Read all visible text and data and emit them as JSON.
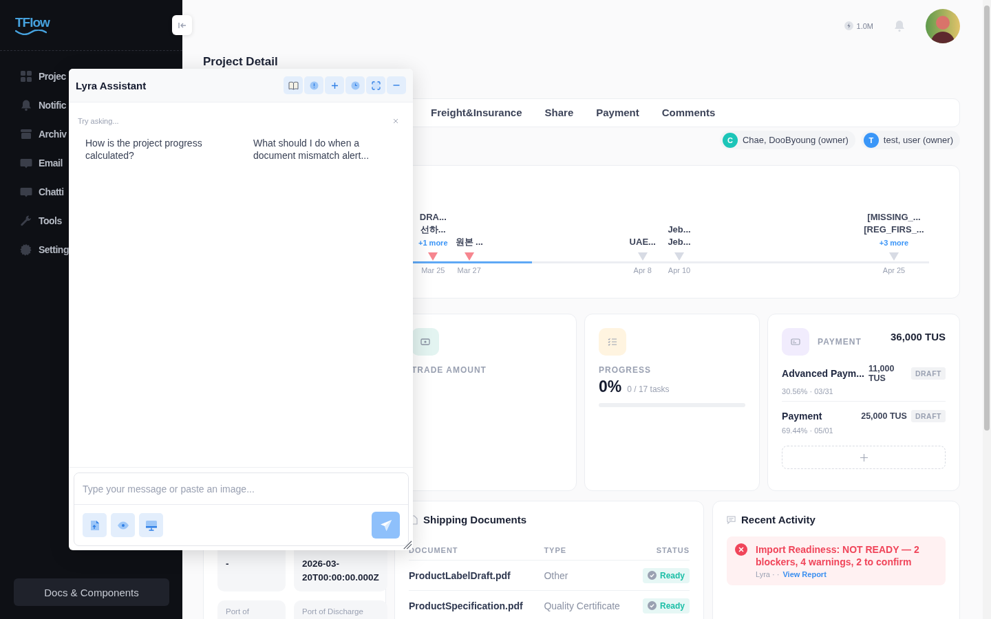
{
  "sidebar": {
    "logo": "TFlow",
    "items": [
      {
        "label": "Projec"
      },
      {
        "label": "Notific"
      },
      {
        "label": "Archiv"
      },
      {
        "label": "Email"
      },
      {
        "label": "Chatti"
      },
      {
        "label": "Tools"
      },
      {
        "label": "Setting"
      }
    ],
    "docs_button": "Docs & Components"
  },
  "header": {
    "credits": "1.0M"
  },
  "page_title": "Project Detail",
  "tabs": [
    {
      "label": "Freight&Insurance",
      "selected": false
    },
    {
      "label": "Share",
      "selected": false
    },
    {
      "label": "Payment",
      "selected": false
    },
    {
      "label": "Comments",
      "selected": false
    }
  ],
  "owners": [
    {
      "initial": "C",
      "name": "Chae, DooByoung (owner)",
      "color": "#1cc5b8"
    },
    {
      "initial": "T",
      "name": "test, user (owner)",
      "color": "#3a96f8"
    }
  ],
  "timeline": {
    "level": 0.23,
    "events": [
      {
        "labels": [
          "DRA...",
          "선하..."
        ],
        "more": "+1 more",
        "date": "Mar 25",
        "color": "#f6868f",
        "level": 0.039
      },
      {
        "labels": [
          "원본 ..."
        ],
        "date": "Mar 27",
        "color": "#f6868f",
        "level": 0.109
      },
      {
        "labels": [
          "UAE..."
        ],
        "date": "Apr 8",
        "color": "#d7dbe4",
        "level": 0.445
      },
      {
        "labels": [
          "Jeb...",
          "Jeb..."
        ],
        "date": "Apr 10",
        "color": "#d7dbe4",
        "level": 0.516
      },
      {
        "labels": [
          "[MISSING_...",
          "[REG_FIRS_..."
        ],
        "more": "+3 more",
        "date": "Apr 25",
        "color": "#d7dbe4",
        "level": 0.932
      }
    ]
  },
  "trade_amount": {
    "label": "TRADE AMOUNT"
  },
  "progress": {
    "label": "PROGRESS",
    "value": "0%",
    "detail": "0 / 17 tasks",
    "level": 0
  },
  "payment": {
    "label": "PAYMENT",
    "total": "36,000 TUS",
    "items": [
      {
        "name": "Advanced Paym...",
        "amount": "11,000 TUS",
        "status": "DRAFT",
        "detail": "30.56% · 03/31"
      },
      {
        "name": "Payment",
        "amount": "25,000 TUS",
        "status": "DRAFT",
        "detail": "69.44% · 05/01"
      }
    ]
  },
  "shipping_terms": {
    "fields": [
      {
        "value": "-"
      },
      {
        "value": "2026-03-20T00:00:00.000Z"
      },
      {
        "label": "Port of"
      },
      {
        "label": "Port of Discharge"
      }
    ]
  },
  "shipping_documents": {
    "title": "Shipping Documents",
    "columns": [
      "DOCUMENT",
      "TYPE",
      "STATUS"
    ],
    "rows": [
      {
        "document": "ProductLabelDraft.pdf",
        "type": "Other",
        "status": "Ready"
      },
      {
        "document": "ProductSpecification.pdf",
        "type": "Quality Certificate",
        "status": "Ready"
      }
    ]
  },
  "recent_activity": {
    "title": "Recent Activity",
    "alerts": [
      {
        "kind": "error",
        "message": "Import Readiness: NOT READY — 2 blockers, 4 warnings, 2 to confirm",
        "meta": "Lyra · ·",
        "link": "View Report"
      }
    ]
  },
  "assistant": {
    "title": "Lyra Assistant",
    "prompt": "Try asking...",
    "suggestions": [
      "How is the project progress calculated?",
      "What should I do when a document mismatch alert..."
    ],
    "input": {
      "placeholder": "Type your message or paste an image..."
    }
  }
}
